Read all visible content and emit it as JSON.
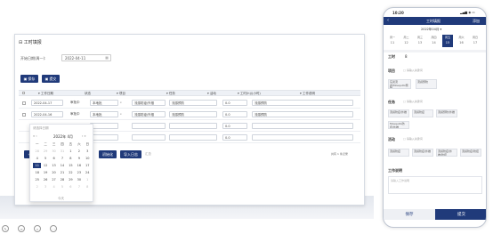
{
  "page": {
    "title": "工时填报",
    "date_label": "开始日期(周一):",
    "date_value": "2022-04-11"
  },
  "toolbar": {
    "save": "保存",
    "submit": "提交"
  },
  "table": {
    "headers": [
      "工作日期",
      "状态",
      "项目",
      "任务",
      "活动",
      "工时(h)/(小时)",
      "工作说明"
    ],
    "rows": [
      {
        "date": "2022-04-17",
        "status": "审批中",
        "project": "本地批",
        "task": "流感防疫/外推",
        "activity": "流感预防",
        "hours": "0.0",
        "desc": "流感预防"
      },
      {
        "date": "2022-04-16",
        "status": "审批中",
        "project": "本地批",
        "task": "流感防疫/外推",
        "activity": "流感预防",
        "hours": "0.0",
        "desc": "流感预防"
      },
      {
        "date": "",
        "status": "",
        "project": "",
        "task": "",
        "activity": "",
        "hours": "0.0",
        "desc": ""
      },
      {
        "date": "",
        "status": "",
        "project": "",
        "task": "",
        "activity": "",
        "hours": "0.0",
        "desc": ""
      }
    ],
    "bottom_buttons": [
      "初始化",
      "导入日志"
    ],
    "bottom_extra": "汇总",
    "pagination": "共有 1 条记录"
  },
  "calendar": {
    "placeholder": "请选择日期",
    "prev": "«  ‹",
    "title": "2022年 4月",
    "next": "›  »",
    "weekdays": [
      "一",
      "二",
      "三",
      "四",
      "五",
      "六",
      "日"
    ],
    "days": [
      [
        "28",
        "o"
      ],
      [
        "29",
        "o"
      ],
      [
        "30",
        "o"
      ],
      [
        "31",
        "o"
      ],
      [
        "1",
        ""
      ],
      [
        "2",
        ""
      ],
      [
        "3",
        ""
      ],
      [
        "4",
        ""
      ],
      [
        "5",
        ""
      ],
      [
        "6",
        ""
      ],
      [
        "7",
        ""
      ],
      [
        "8",
        ""
      ],
      [
        "9",
        ""
      ],
      [
        "10",
        ""
      ],
      [
        "11",
        "sel"
      ],
      [
        "12",
        ""
      ],
      [
        "13",
        ""
      ],
      [
        "14",
        ""
      ],
      [
        "15",
        ""
      ],
      [
        "16",
        ""
      ],
      [
        "17",
        ""
      ],
      [
        "18",
        ""
      ],
      [
        "19",
        ""
      ],
      [
        "20",
        ""
      ],
      [
        "21",
        ""
      ],
      [
        "22",
        ""
      ],
      [
        "23",
        ""
      ],
      [
        "24",
        ""
      ],
      [
        "25",
        ""
      ],
      [
        "26",
        ""
      ],
      [
        "27",
        ""
      ],
      [
        "28",
        ""
      ],
      [
        "29",
        ""
      ],
      [
        "30",
        ""
      ],
      [
        "1",
        "o"
      ],
      [
        "2",
        "o"
      ],
      [
        "3",
        "o"
      ],
      [
        "4",
        "o"
      ],
      [
        "5",
        "o"
      ],
      [
        "6",
        "o"
      ],
      [
        "7",
        "o"
      ],
      [
        "8",
        "o"
      ]
    ],
    "today": "今天"
  },
  "phone": {
    "time": "10:20",
    "signal": "▂▄▆ ◉ ▭",
    "back": "‹",
    "title": "工时填报",
    "action": "添加",
    "month": "2022年04月 ▾",
    "week_days": [
      "周一",
      "周二",
      "周三",
      "周四",
      "周五",
      "周六",
      "周日"
    ],
    "week_dates": [
      "11",
      "12",
      "13",
      "14",
      "15",
      "16",
      "17"
    ],
    "work_hours_label": "工时",
    "work_hours_value": "8",
    "project_label": "项目",
    "project_hint": "□ 请输入关键词",
    "project_chips": [
      "东莞流感/Mosquito预防",
      "流感预防"
    ],
    "task_label": "任务",
    "task_hint": "□ 请输入关键词",
    "task_chips": [
      "流感防疫/外推",
      "流感防疫",
      "流感预防/外推",
      "Mosquito防控/外推"
    ],
    "activity_label": "活动",
    "activity_hint": "□ 请输入关键词",
    "activity_chips": [
      "流感防疫",
      "流感防疫/外推",
      "流感防疫/外推/防控",
      "流感防疫/防控"
    ],
    "desc_label": "工作说明",
    "desc_placeholder": "请输入工作说明",
    "save": "保存",
    "submit": "提交"
  },
  "colors": {
    "primary": "#203a7a",
    "border": "#cfd4dc"
  }
}
